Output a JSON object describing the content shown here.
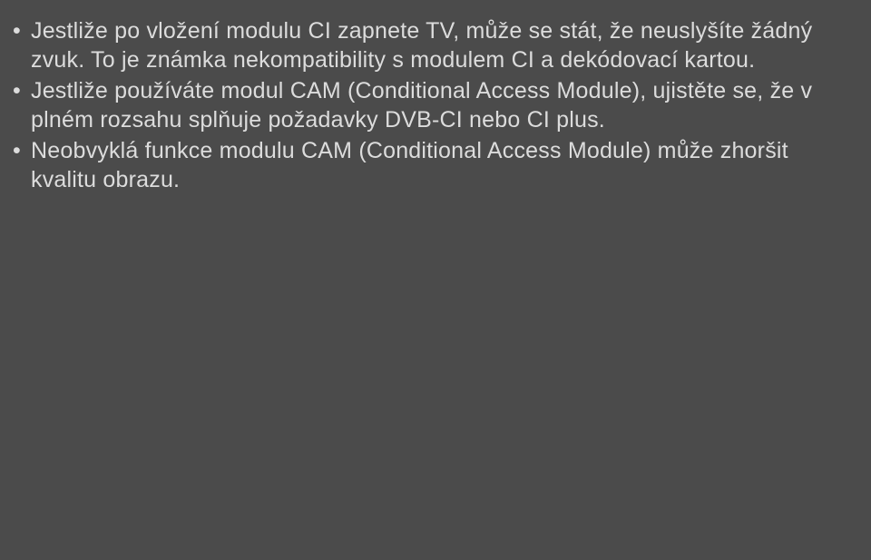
{
  "bullets": [
    "Jestliže po vložení modulu CI zapnete TV, může se stát, že neuslyšíte žádný zvuk. To je známka nekompatibility s modulem CI a dekódovací kartou.",
    "Jestliže používáte modul CAM (Conditional Access Module), ujistěte se, že v plném rozsahu splňuje požadavky DVB-CI nebo CI plus.",
    "Neobvyklá funkce modulu CAM (Conditional Access Module) může zhoršit kvalitu obrazu."
  ]
}
